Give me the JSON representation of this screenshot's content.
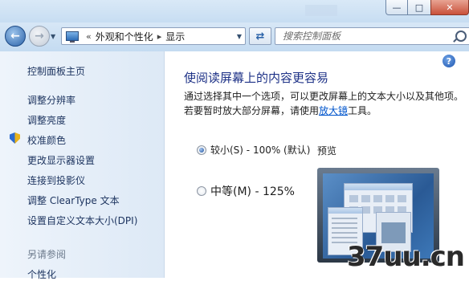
{
  "window": {
    "minimize_glyph": "—",
    "maximize_glyph": "□",
    "close_glyph": "✕"
  },
  "nav": {
    "back_glyph": "←",
    "forward_glyph": "→",
    "dropdown_glyph": "▼",
    "overflow_glyph": "«",
    "breadcrumbs": [
      "外观和个性化",
      "显示"
    ],
    "crumb_separator": "▸",
    "refresh_glyph": "⇄",
    "search_placeholder": "搜索控制面板"
  },
  "sidebar": {
    "home": "控制面板主页",
    "items": [
      "调整分辨率",
      "调整亮度",
      "校准颜色",
      "更改显示器设置",
      "连接到投影仪",
      "调整 ClearType 文本",
      "设置自定义文本大小(DPI)"
    ],
    "see_also_title": "另请参阅",
    "see_also_items": [
      "个性化"
    ]
  },
  "main": {
    "help_glyph": "?",
    "title": "使阅读屏幕上的内容更容易",
    "desc_part1": "通过选择其中一个选项，可以更改屏幕上的文本大小以及其他项。若要暂时放大部分屏幕，请使用",
    "desc_link": "放大镜",
    "desc_part2": "工具。",
    "options": [
      {
        "label": "较小(S) - 100% (默认)",
        "checked": true
      },
      {
        "label": "中等(M) - 125%",
        "checked": false
      }
    ],
    "preview_label": "预览"
  },
  "watermark": "37uu.cn"
}
